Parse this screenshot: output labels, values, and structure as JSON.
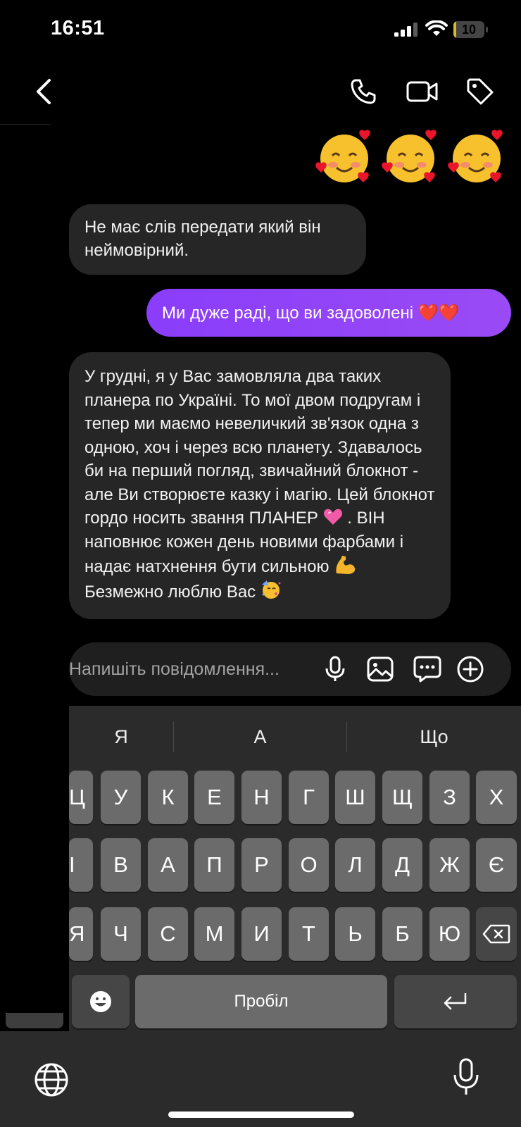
{
  "status_bar": {
    "time": "16:51",
    "battery": "10",
    "battery_level": 0.1
  },
  "header": {
    "icons": [
      "chevron-left-icon",
      "phone-icon",
      "video-camera-icon",
      "tag-icon"
    ]
  },
  "messages": {
    "reaction_emojis": [
      "smiling-face-with-hearts",
      "smiling-face-with-hearts",
      "smiling-face-with-hearts"
    ],
    "m1": {
      "text": "Не має слів передати який він неймовірний."
    },
    "m2": {
      "text": "Ми дуже раді, що ви задоволені",
      "emoji": "❤️❤️"
    },
    "m3": {
      "text_a": "У грудні, я у Вас замовляла два таких планера по Україні. То мої двом подругам і тепер ми маємо невеличкий зв'язок одна з одною, хоч і через всю планету. Здавалось би на перший погляд, звичайний блокнот - але Ви створюєте казку і магію. Цей блокнот гордо носить звання ПЛАНЕР",
      "text_b": ". ВІН наповнює кожен день новими фарбами і надає натхнення бути сильною",
      "text_c": "Безмежно люблю Вас",
      "emojis": [
        "pink-heart",
        "flexed-biceps",
        "partying-face"
      ]
    }
  },
  "composer": {
    "placeholder": "Напишіть повідомлення...",
    "icons": [
      "microphone-icon",
      "image-icon",
      "message-bubble-icon",
      "plus-circle-icon"
    ]
  },
  "keyboard": {
    "suggestions": [
      "Я",
      "А",
      "Що"
    ],
    "row1": [
      "Ц",
      "У",
      "К",
      "Е",
      "Н",
      "Г",
      "Ш",
      "Щ",
      "З",
      "Х"
    ],
    "row2": [
      "І",
      "В",
      "А",
      "П",
      "Р",
      "О",
      "Л",
      "Д",
      "Ж",
      "Є"
    ],
    "row3": [
      "Я",
      "Ч",
      "С",
      "М",
      "И",
      "Т",
      "Ь",
      "Б",
      "Ю"
    ],
    "space_label": "Пробіл"
  },
  "colors": {
    "outgoing_bubble": "#8a3dfa",
    "incoming_bubble": "#262626",
    "keyboard_bg": "#2b2b2b",
    "key": "#6b6b6b"
  }
}
